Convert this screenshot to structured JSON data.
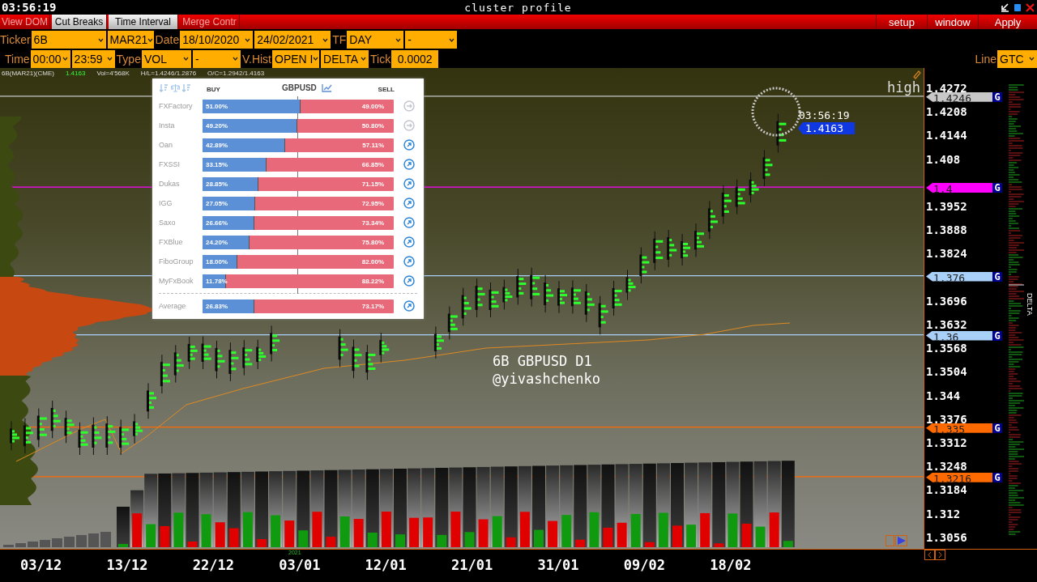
{
  "title_bar": {
    "clock": "03:56:19",
    "title": "cluster profile"
  },
  "menu": {
    "tabs": [
      {
        "label": "View DOM",
        "selected": false
      },
      {
        "label": "Cut Breaks",
        "selected": true
      },
      {
        "label": "Time Interval",
        "selected": true
      },
      {
        "label": "Merge Contr",
        "selected": false
      }
    ],
    "buttons": [
      "setup",
      "window",
      "Apply"
    ]
  },
  "toolbar": {
    "ticker_row": [
      {
        "kind": "label",
        "text": "Ticker"
      },
      {
        "kind": "dropdown",
        "value": "6B"
      },
      {
        "kind": "dropdown",
        "value": "MAR21"
      },
      {
        "kind": "label",
        "text": "Date"
      },
      {
        "kind": "dropdown",
        "value": "18/10/2020"
      },
      {
        "kind": "dropdown",
        "value": "24/02/2021"
      },
      {
        "kind": "label",
        "text": "TF"
      },
      {
        "kind": "dropdown",
        "value": "DAY"
      },
      {
        "kind": "dropdown",
        "value": "-"
      }
    ],
    "time_row": [
      {
        "kind": "label",
        "text": "Time"
      },
      {
        "kind": "dropdown",
        "value": "00:00"
      },
      {
        "kind": "dropdown",
        "value": "23:59"
      },
      {
        "kind": "label",
        "text": "Type"
      },
      {
        "kind": "dropdown",
        "value": "VOL"
      },
      {
        "kind": "dropdown",
        "value": "-"
      },
      {
        "kind": "label",
        "text": "V.Hist"
      },
      {
        "kind": "dropdown",
        "value": "OPEN I"
      },
      {
        "kind": "dropdown",
        "value": "DELTA"
      },
      {
        "kind": "label",
        "text": "Tick"
      },
      {
        "kind": "field",
        "value": "0.0002"
      }
    ],
    "line": {
      "label": "Line",
      "value": "GTC"
    }
  },
  "chart": {
    "info": {
      "symbol": "6B(MAR21)(CME)",
      "last": "1.4163",
      "volume": "Vol=4'568K",
      "high_low": "H/L=1.4246/1.2876",
      "open_close": "O/C=1.2942/1.4163"
    },
    "high_label": "high",
    "timer": "03:56:19",
    "current_price": "1.4163",
    "annotation": [
      "6B GBPUSD D1",
      "@yivashchenko"
    ],
    "sentiment": {
      "buy_label": "BUY",
      "symbol": "GBPUSD",
      "sell_label": "SELL",
      "rows": [
        {
          "name": "FXFactory",
          "buy": "51.00%",
          "sell": "49.00%",
          "level": 0.51,
          "active": false
        },
        {
          "name": "Insta",
          "buy": "49.20%",
          "sell": "50.80%",
          "level": 0.492,
          "active": false
        },
        {
          "name": "Oan",
          "buy": "42.89%",
          "sell": "57.11%",
          "level": 0.4289,
          "active": true
        },
        {
          "name": "FXSSI",
          "buy": "33.15%",
          "sell": "66.85%",
          "level": 0.3315,
          "active": true
        },
        {
          "name": "Dukas",
          "buy": "28.85%",
          "sell": "71.15%",
          "level": 0.2885,
          "active": true
        },
        {
          "name": "IGG",
          "buy": "27.05%",
          "sell": "72.95%",
          "level": 0.2705,
          "active": true
        },
        {
          "name": "Saxo",
          "buy": "26.66%",
          "sell": "73.34%",
          "level": 0.2666,
          "active": true
        },
        {
          "name": "FXBlue",
          "buy": "24.20%",
          "sell": "75.80%",
          "level": 0.242,
          "active": true
        },
        {
          "name": "FiboGroup",
          "buy": "18.00%",
          "sell": "82.00%",
          "level": 0.18,
          "active": true
        },
        {
          "name": "MyFxBook",
          "buy": "11.78%",
          "sell": "88.22%",
          "level": 0.1178,
          "active": true
        }
      ],
      "average": {
        "name": "Average",
        "buy": "26.83%",
        "sell": "73.17%",
        "level": 0.2683,
        "active": true
      }
    }
  },
  "price_axis": {
    "ticks": [
      "1.4272",
      "1.4208",
      "1.4144",
      "1.408",
      "1.3952",
      "1.3888",
      "1.3824",
      "1.3696",
      "1.3632",
      "1.3568",
      "1.3504",
      "1.344",
      "1.3376",
      "1.3312",
      "1.3248",
      "1.3184",
      "1.312",
      "1.3056"
    ],
    "markers": [
      {
        "price": "1.4246",
        "color": "#c8c8c8",
        "badge": "G"
      },
      {
        "price": "1.4",
        "color": "#ff00ff",
        "badge": "G"
      },
      {
        "price": "1.376",
        "color": "#a8d0f8",
        "badge": "G"
      },
      {
        "price": "1.36",
        "color": "#a8d0f8",
        "badge": "G"
      },
      {
        "price": "1.335",
        "color": "#ff6a00",
        "badge": "G"
      },
      {
        "price": "1.3216",
        "color": "#ff6a00",
        "badge": "G"
      }
    ]
  },
  "delta_label": "DELTA",
  "date_axis": {
    "labels": [
      "03/12",
      "13/12",
      "22/12",
      "03/01",
      "12/01",
      "21/01",
      "31/01",
      "09/02",
      "18/02"
    ],
    "year": "2021"
  }
}
